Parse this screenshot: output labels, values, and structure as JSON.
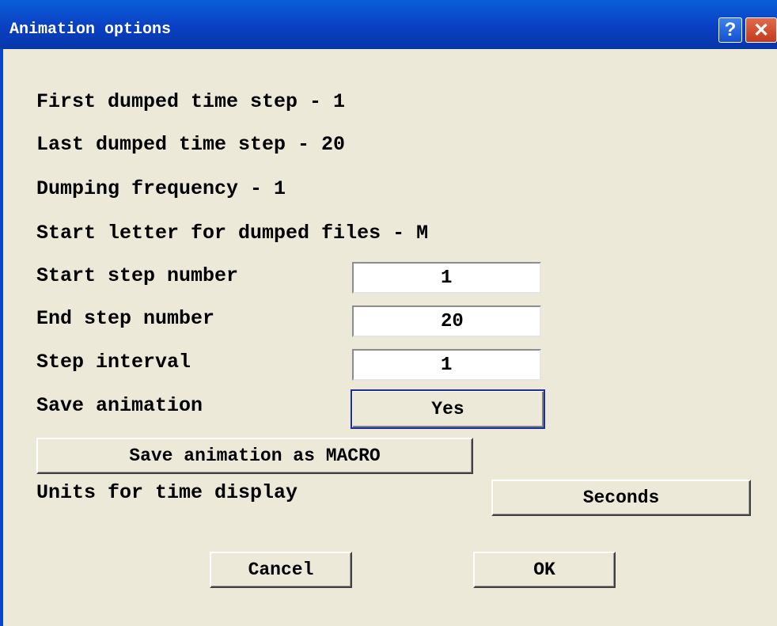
{
  "window": {
    "title": "Animation options",
    "help_glyph": "?",
    "close_glyph": "✕"
  },
  "info": {
    "first_step": "First dumped time step - 1",
    "last_step": "Last dumped time step - 20",
    "frequency": "Dumping frequency - 1",
    "start_letter": "Start letter for dumped files - M"
  },
  "fields": {
    "start_label": "Start step number",
    "start_value": "1",
    "end_label": "End step number",
    "end_value": "20",
    "interval_label": "Step interval",
    "interval_value": "1"
  },
  "save": {
    "label": "Save animation",
    "value": "Yes",
    "macro_button": "Save animation as MACRO"
  },
  "units": {
    "label": "Units for time display",
    "value": "Seconds"
  },
  "actions": {
    "cancel": "Cancel",
    "ok": "OK"
  },
  "colors": {
    "titlebar": "#0a46cc",
    "dialog_bg": "#ece9d8",
    "focus_border": "#1c2f9c"
  }
}
